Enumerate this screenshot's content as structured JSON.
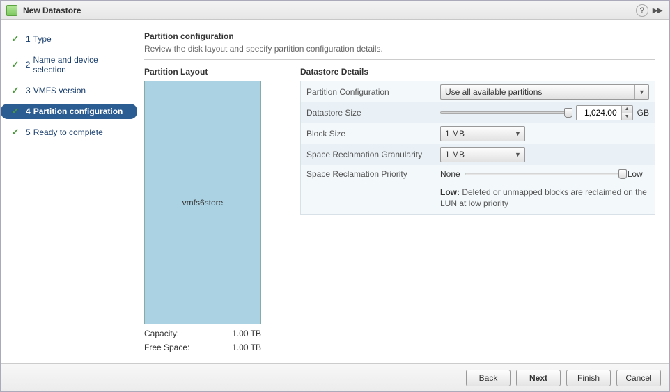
{
  "window": {
    "title": "New Datastore"
  },
  "steps": [
    {
      "num": "1",
      "label": "Type"
    },
    {
      "num": "2",
      "label": "Name and device selection"
    },
    {
      "num": "3",
      "label": "VMFS version"
    },
    {
      "num": "4",
      "label": "Partition configuration"
    },
    {
      "num": "5",
      "label": "Ready to complete"
    }
  ],
  "header": {
    "title": "Partition configuration",
    "desc": "Review the disk layout and specify partition configuration details."
  },
  "partition": {
    "section_title": "Partition Layout",
    "name": "vmfs6store",
    "capacity_label": "Capacity:",
    "capacity": "1.00 TB",
    "free_label": "Free Space:",
    "free": "1.00 TB"
  },
  "details": {
    "section_title": "Datastore Details",
    "config_label": "Partition Configuration",
    "config_value": "Use all available partitions",
    "size_label": "Datastore Size",
    "size_value": "1,024.00",
    "size_unit": "GB",
    "block_label": "Block Size",
    "block_value": "1 MB",
    "reclaim_gran_label": "Space Reclamation Granularity",
    "reclaim_gran_value": "1 MB",
    "reclaim_pri_label": "Space Reclamation Priority",
    "reclaim_pri_left": "None",
    "reclaim_pri_right": "Low",
    "reclaim_note_bold": "Low:",
    "reclaim_note_text": " Deleted or unmapped blocks are reclaimed on the LUN at low priority"
  },
  "buttons": {
    "back": "Back",
    "next": "Next",
    "finish": "Finish",
    "cancel": "Cancel"
  }
}
